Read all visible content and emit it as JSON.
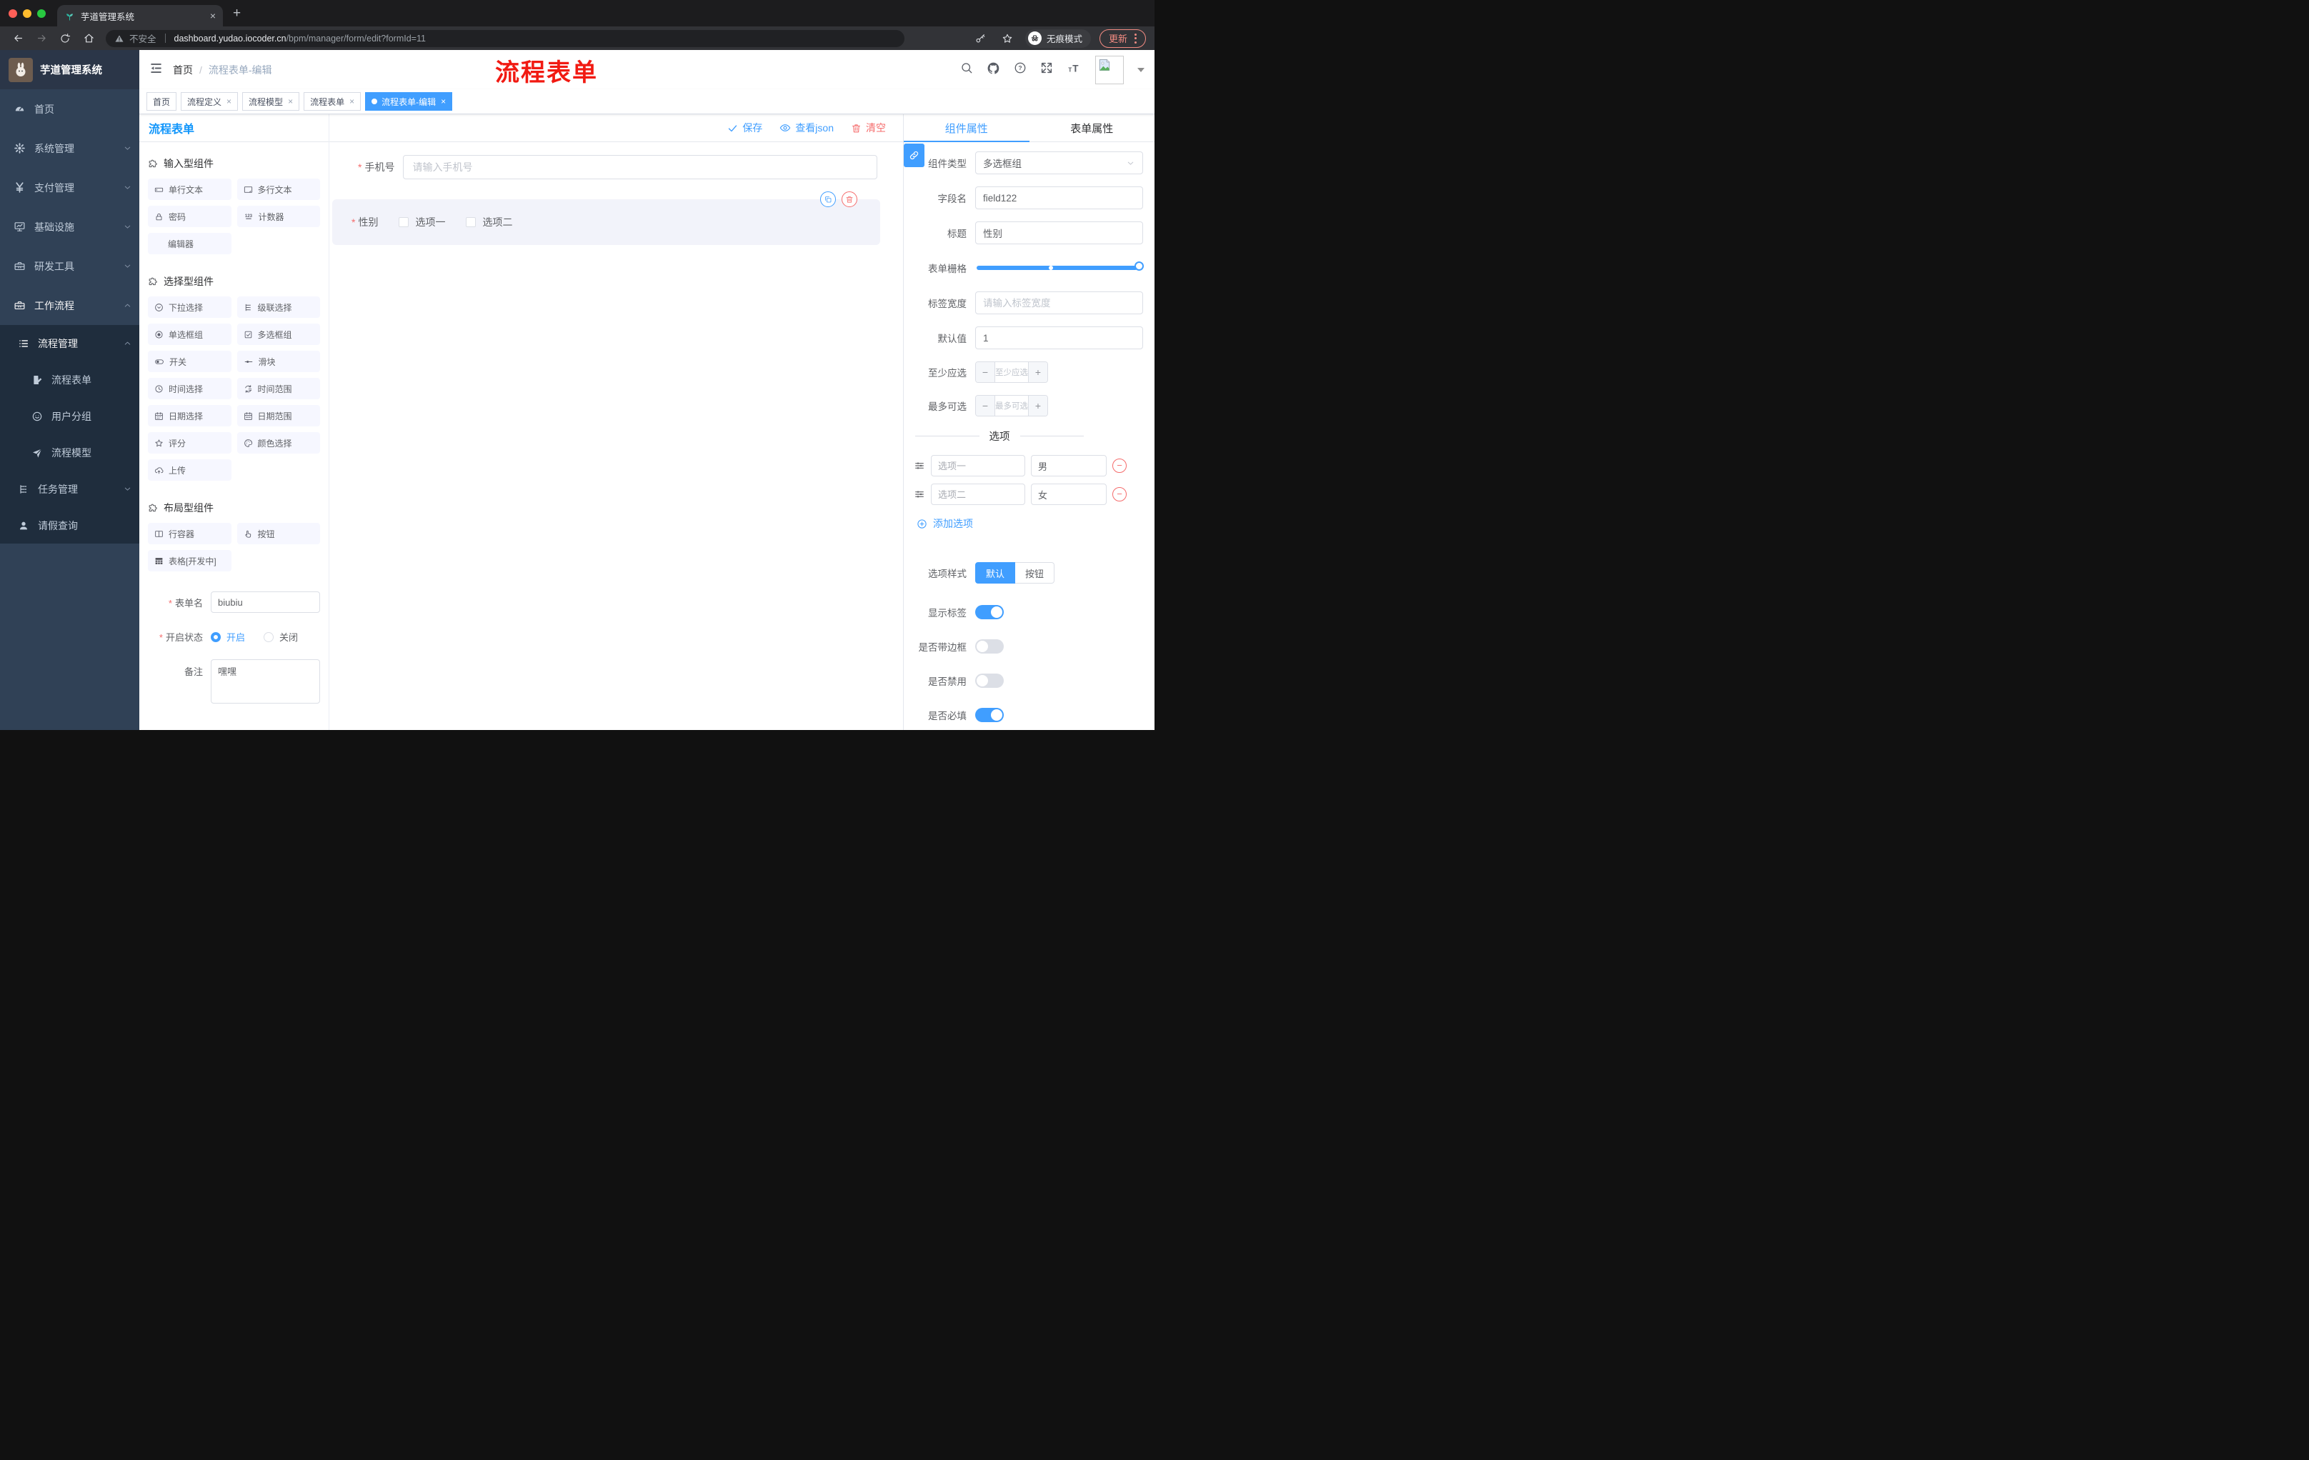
{
  "browser": {
    "tab_title": "芋道管理系统",
    "security_label": "不安全",
    "url_host": "dashboard.yudao.iocoder.cn",
    "url_path": "/bpm/manager/form/edit?formId=11",
    "incognito_label": "无痕模式",
    "update_label": "更新"
  },
  "sidebar": {
    "app_title": "芋道管理系统",
    "menu": {
      "home": "首页",
      "system": "系统管理",
      "pay": "支付管理",
      "infra": "基础设施",
      "dev": "研发工具",
      "workflow": "工作流程",
      "process_group": "流程管理",
      "form": "流程表单",
      "user_group": "用户分组",
      "model": "流程模型",
      "task": "任务管理",
      "leave": "请假查询"
    }
  },
  "header": {
    "breadcrumb_home": "首页",
    "breadcrumb_current": "流程表单-编辑",
    "annotation": "流程表单"
  },
  "tags": {
    "items": [
      "首页",
      "流程定义",
      "流程模型",
      "流程表单",
      "流程表单-编辑"
    ]
  },
  "designer": {
    "panel_title": "流程表单",
    "toolbar": {
      "save": "保存",
      "view_json": "查看json",
      "clear": "清空"
    },
    "palette": {
      "sections": [
        {
          "title": "输入型组件",
          "items": [
            "单行文本",
            "多行文本",
            "密码",
            "计数器",
            "编辑器"
          ]
        },
        {
          "title": "选择型组件",
          "items": [
            "下拉选择",
            "级联选择",
            "单选框组",
            "多选框组",
            "开关",
            "滑块",
            "时间选择",
            "时间范围",
            "日期选择",
            "日期范围",
            "评分",
            "颜色选择",
            "上传"
          ]
        },
        {
          "title": "布局型组件",
          "items": [
            "行容器",
            "按钮",
            "表格[开发中]"
          ]
        }
      ]
    },
    "meta_form": {
      "name_label": "表单名",
      "name_value": "biubiu",
      "status_label": "开启状态",
      "status_on": "开启",
      "status_off": "关闭",
      "remark_label": "备注",
      "remark_value": "嘿嘿"
    }
  },
  "canvas": {
    "phone_label": "手机号",
    "phone_placeholder": "请输入手机号",
    "gender_label": "性别",
    "gender_option1": "选项一",
    "gender_option2": "选项二"
  },
  "props": {
    "tab_component": "组件属性",
    "tab_form": "表单属性",
    "component_type_label": "组件类型",
    "component_type_value": "多选框组",
    "field_name_label": "字段名",
    "field_name_value": "field122",
    "title_label": "标题",
    "title_value": "性别",
    "grid_label": "表单栅格",
    "label_width_label": "标签宽度",
    "label_width_placeholder": "请输入标签宽度",
    "default_label": "默认值",
    "default_value": "1",
    "min_label": "至少应选",
    "min_placeholder": "至少应选",
    "max_label": "最多可选",
    "max_placeholder": "最多可选",
    "options_title": "选项",
    "options": [
      {
        "name": "选项一",
        "value": "男"
      },
      {
        "name": "选项二",
        "value": "女"
      }
    ],
    "add_option": "添加选项",
    "style_label": "选项样式",
    "style_default": "默认",
    "style_button": "按钮",
    "show_label": "显示标签",
    "border_label": "是否带边框",
    "disabled_label": "是否禁用",
    "required_label": "是否必填"
  },
  "colors": {
    "accent": "#409eff",
    "danger": "#f56c6c",
    "sidebar": "#304156"
  }
}
